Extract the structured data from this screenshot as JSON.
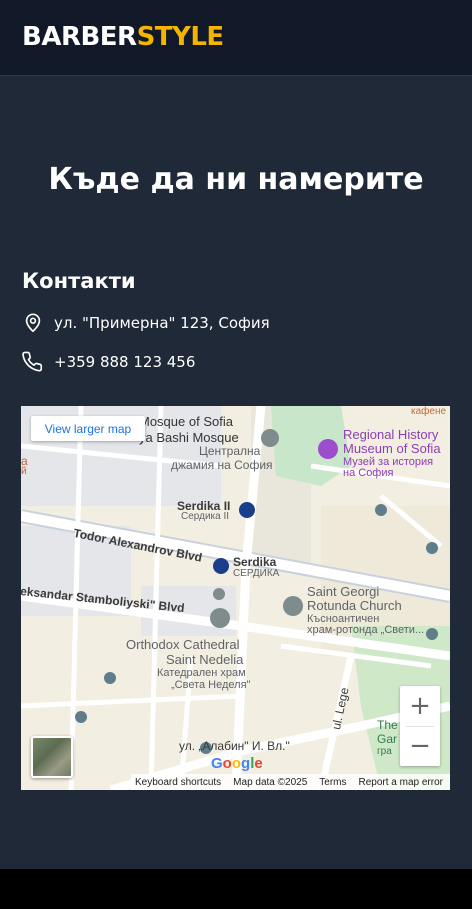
{
  "brand": {
    "part1": "BARBER",
    "part2": "STYLE",
    "accent_color": "#f5b400"
  },
  "section": {
    "title": "Къде да ни намерите"
  },
  "contacts": {
    "title": "Контакти",
    "address": "ул. \"Примерна\" 123, София",
    "address_icon": "location-pin-icon",
    "phone": "+359 888 123 456",
    "phone_icon": "phone-icon"
  },
  "map": {
    "larger_map_label": "View larger map",
    "zoom_in": "+",
    "zoom_out": "−",
    "labels": {
      "mosque1": "Mosque of Sofia",
      "mosque2": "ya Bashi Mosque",
      "mosque_bg1": "Централна",
      "mosque_bg2": "джамия на София",
      "kafene": "кафене",
      "museum1": "Regional History",
      "museum2": "Museum of Sofia",
      "museum_bg1": "Музей за история",
      "museum_bg2": "на София",
      "serdika2": "Serdika II",
      "serdika2_bg": "Сердика II",
      "serdika": "Serdika",
      "serdika_bg": "СЕРДИКА",
      "todor": "Todor Alexandrov Blvd",
      "stamboliyski": "eksandar Stamboliyski\" Blvd",
      "georgi1": "Saint Georgi",
      "georgi2": "Rotunda Church",
      "georgi_bg1": "Късноантичен",
      "georgi_bg2": "храм-ротонда „Свети...",
      "nedelia1": "Orthodox Cathedral",
      "nedelia2": "Saint Nedelia",
      "nedelia_bg1": "Катедрален храм",
      "nedelia_bg2": "„Света Неделя\"",
      "lege": "ul. Lege",
      "alabin": "ул. „Алабин\" И. Вл.\"",
      "the_gar1": "The",
      "the_gar2": "Gar",
      "the_gar3": "гра",
      "left_a": "a",
      "left_b": "й"
    },
    "attribution": {
      "logo": "Google",
      "shortcuts": "Keyboard shortcuts",
      "data": "Map data ©2025",
      "terms": "Terms",
      "report": "Report a map error"
    }
  }
}
